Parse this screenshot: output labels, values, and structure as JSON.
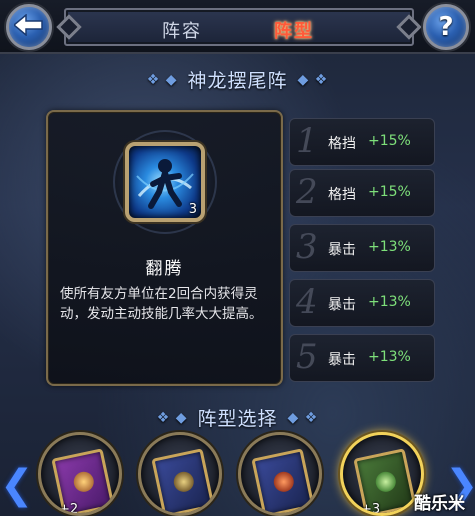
{
  "header": {
    "back_icon": "back-arrow-icon",
    "help_label": "?",
    "tabs": [
      {
        "label": "阵容",
        "active": false
      },
      {
        "label": "阵型",
        "active": true
      }
    ]
  },
  "formation": {
    "title": "神龙摆尾阵"
  },
  "skill": {
    "icon": "figure-swirl-icon",
    "level": "3",
    "name": "翻腾",
    "description": "使所有友方单位在2回合内获得灵动，发动主动技能几率大大提高。"
  },
  "bonuses": [
    {
      "index": "1",
      "stat": "格挡",
      "value": "+15%"
    },
    {
      "index": "2",
      "stat": "格挡",
      "value": "+15%"
    },
    {
      "index": "3",
      "stat": "暴击",
      "value": "+13%"
    },
    {
      "index": "4",
      "stat": "暴击",
      "value": "+13%"
    },
    {
      "index": "5",
      "stat": "暴击",
      "value": "+13%"
    }
  ],
  "selection": {
    "title": "阵型选择",
    "books": [
      {
        "level": "+2",
        "color": "#6a2a8a",
        "selected": false
      },
      {
        "level": "",
        "color": "#2a3a7a",
        "selected": false
      },
      {
        "level": "",
        "color": "#2a3a7a",
        "selected": false
      },
      {
        "level": "+3",
        "color": "#3a6a2a",
        "selected": true
      }
    ]
  },
  "watermark": "酷乐米",
  "colors": {
    "accent_blue": "#4a86ff",
    "active_tab": "#ff5a3a",
    "bonus_value": "#7ee07a",
    "gold_frame": "#8a7a58"
  }
}
